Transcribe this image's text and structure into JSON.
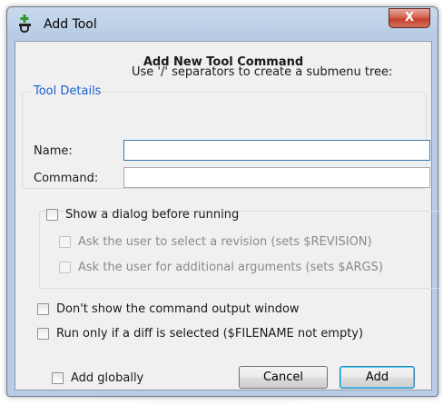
{
  "window": {
    "title": "Add Tool",
    "close_label": "X"
  },
  "heading": "Add New Tool Command",
  "tool_details": {
    "group_title": "Tool Details",
    "hint": "Use '/' separators to create a submenu tree:",
    "name_label": "Name:",
    "name_value": "",
    "command_label": "Command:",
    "command_value": ""
  },
  "options": {
    "show_dialog": {
      "label": "Show a dialog before running",
      "checked": false
    },
    "ask_revision": {
      "label": "Ask the user to select a revision (sets $REVISION)",
      "checked": false,
      "enabled": false
    },
    "ask_arguments": {
      "label": "Ask the user for additional arguments (sets $ARGS)",
      "checked": false,
      "enabled": false
    },
    "no_output_window": {
      "label": "Don't show the command output window",
      "checked": false
    },
    "run_if_diff": {
      "label": "Run only if a diff is selected ($FILENAME not empty)",
      "checked": false
    },
    "add_globally": {
      "label": "Add globally",
      "checked": false
    }
  },
  "buttons": {
    "cancel": "Cancel",
    "add": "Add"
  },
  "icons": {
    "app": "add-tool-icon",
    "close": "close-icon"
  },
  "colors": {
    "group_title": "#1a5fd1",
    "close_button": "#c3402b"
  }
}
